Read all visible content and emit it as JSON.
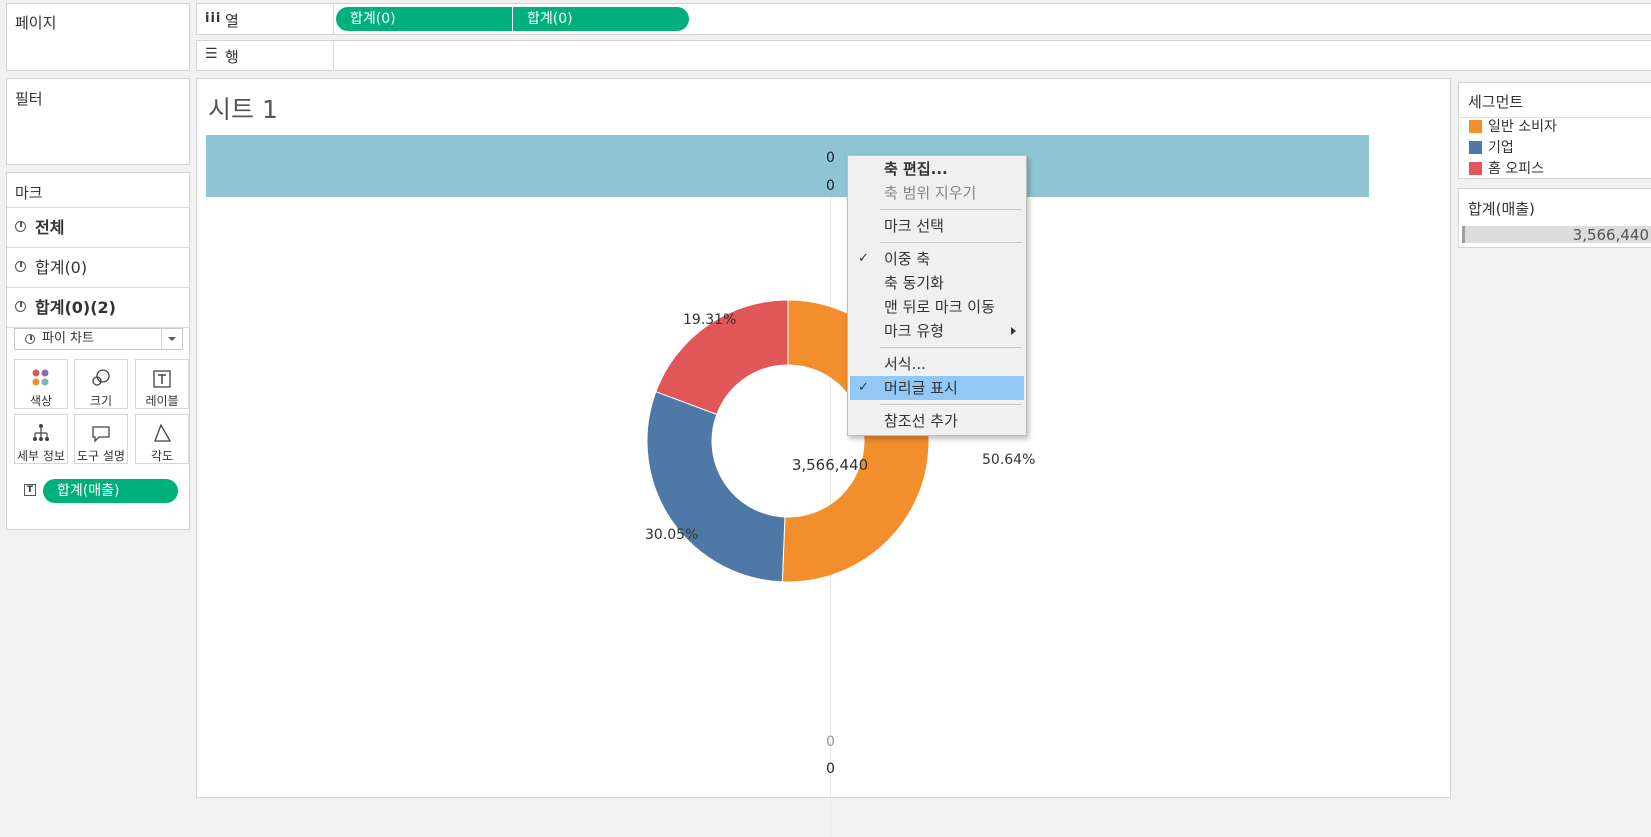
{
  "pages_label": "페이지",
  "columns_shelf": {
    "label": "열",
    "pills": [
      "합계(0)",
      "합계(0)"
    ]
  },
  "rows_shelf": {
    "label": "행"
  },
  "filters_label": "필터",
  "marks": {
    "title": "마크",
    "rows": [
      "전체",
      "합계(0)",
      "합계(0)(2)"
    ],
    "type_select": "파이 차트",
    "buttons": [
      "색상",
      "크기",
      "레이블",
      "세부 정보",
      "도구 설명",
      "각도"
    ],
    "field_pill": "합계(매출)"
  },
  "sheet_title": "시트 1",
  "axis_labels": {
    "top_1": "0",
    "top_2": "0",
    "bottom_1": "0",
    "bottom_2": "0"
  },
  "legend": {
    "title": "세그먼트",
    "items": [
      {
        "label": "일반 소비자",
        "color": "#f28e2b"
      },
      {
        "label": "기업",
        "color": "#4e79a7"
      },
      {
        "label": "홈 오피스",
        "color": "#e15759"
      }
    ]
  },
  "size_card": {
    "title": "합계(매출)",
    "value": "3,566,440"
  },
  "context_menu": {
    "items": [
      {
        "label": "축 편집...",
        "bold": true
      },
      {
        "label": "축 범위 지우기",
        "disabled": true
      },
      {
        "label": "마크 선택"
      },
      {
        "label": "이중 축",
        "checked": true
      },
      {
        "label": "축 동기화"
      },
      {
        "label": "맨 뒤로 마크 이동"
      },
      {
        "label": "마크 유형",
        "submenu": true
      },
      {
        "label": "서식..."
      },
      {
        "label": "머리글 표시",
        "checked": true,
        "highlighted": true
      },
      {
        "label": "참조선 추가"
      }
    ]
  },
  "colors": {
    "pill_green": "#00b07b",
    "header_band": "#8fc4d2",
    "menu_highlight": "#91c8f6"
  },
  "chart_data": {
    "type": "pie",
    "categories": [
      "일반 소비자",
      "기업",
      "홈 오피스"
    ],
    "values": [
      50.64,
      30.05,
      19.31
    ],
    "value_labels": [
      "50.64%",
      "30.05%",
      "19.31%"
    ],
    "colors": [
      "#f28e2b",
      "#4e79a7",
      "#e15759"
    ],
    "center_label": "3,566,440",
    "donut": true
  }
}
